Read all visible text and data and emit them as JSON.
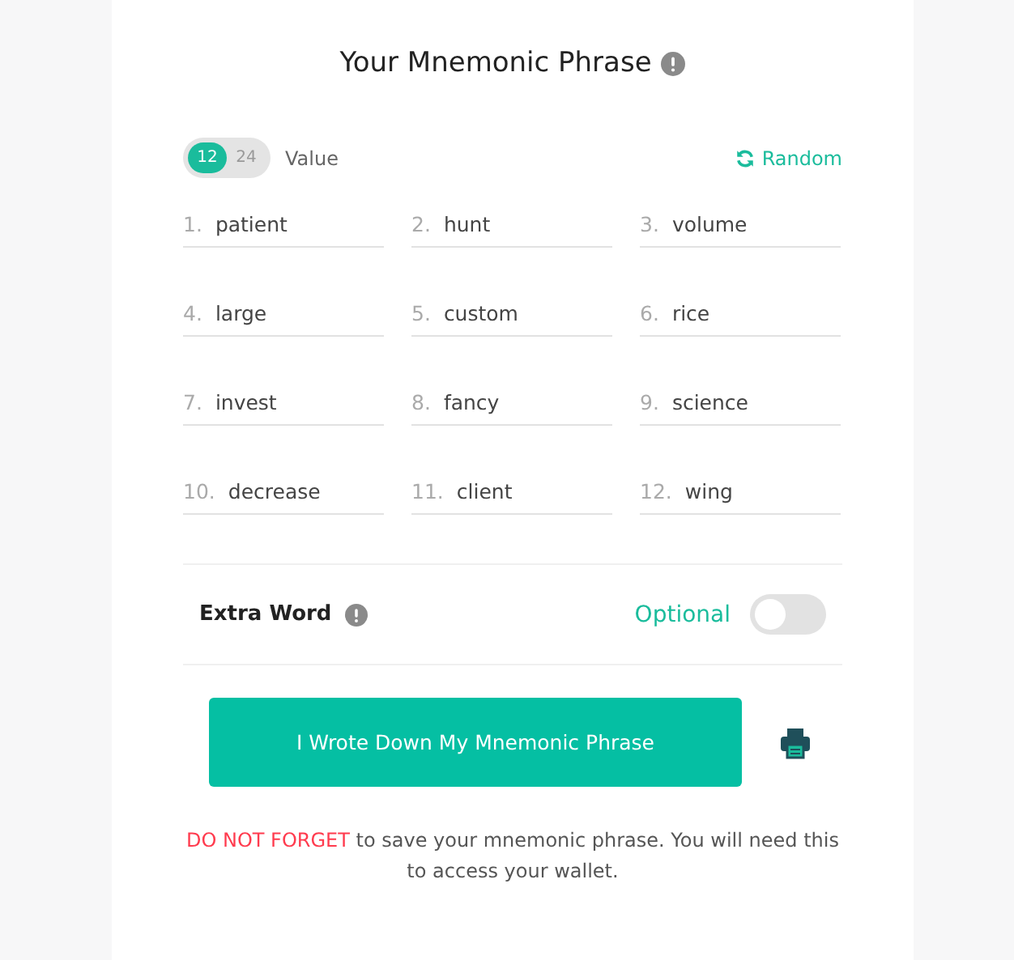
{
  "title": "Your Mnemonic Phrase",
  "length_options": [
    {
      "label": "12",
      "selected": true
    },
    {
      "label": "24",
      "selected": false
    }
  ],
  "length_label": "Value",
  "random_label": "Random",
  "words": [
    {
      "index": "1.",
      "word": "patient"
    },
    {
      "index": "2.",
      "word": "hunt"
    },
    {
      "index": "3.",
      "word": "volume"
    },
    {
      "index": "4.",
      "word": "large"
    },
    {
      "index": "5.",
      "word": "custom"
    },
    {
      "index": "6.",
      "word": "rice"
    },
    {
      "index": "7.",
      "word": "invest"
    },
    {
      "index": "8.",
      "word": "fancy"
    },
    {
      "index": "9.",
      "word": "science"
    },
    {
      "index": "10.",
      "word": "decrease"
    },
    {
      "index": "11.",
      "word": "client"
    },
    {
      "index": "12.",
      "word": "wing"
    }
  ],
  "extra_word": {
    "label": "Extra Word",
    "optional_label": "Optional",
    "on": false
  },
  "confirm_button": "I Wrote Down My Mnemonic Phrase",
  "note": {
    "emphasis": "DO NOT FORGET",
    "text": " to save your mnemonic phrase. You will need this to access your wallet."
  }
}
